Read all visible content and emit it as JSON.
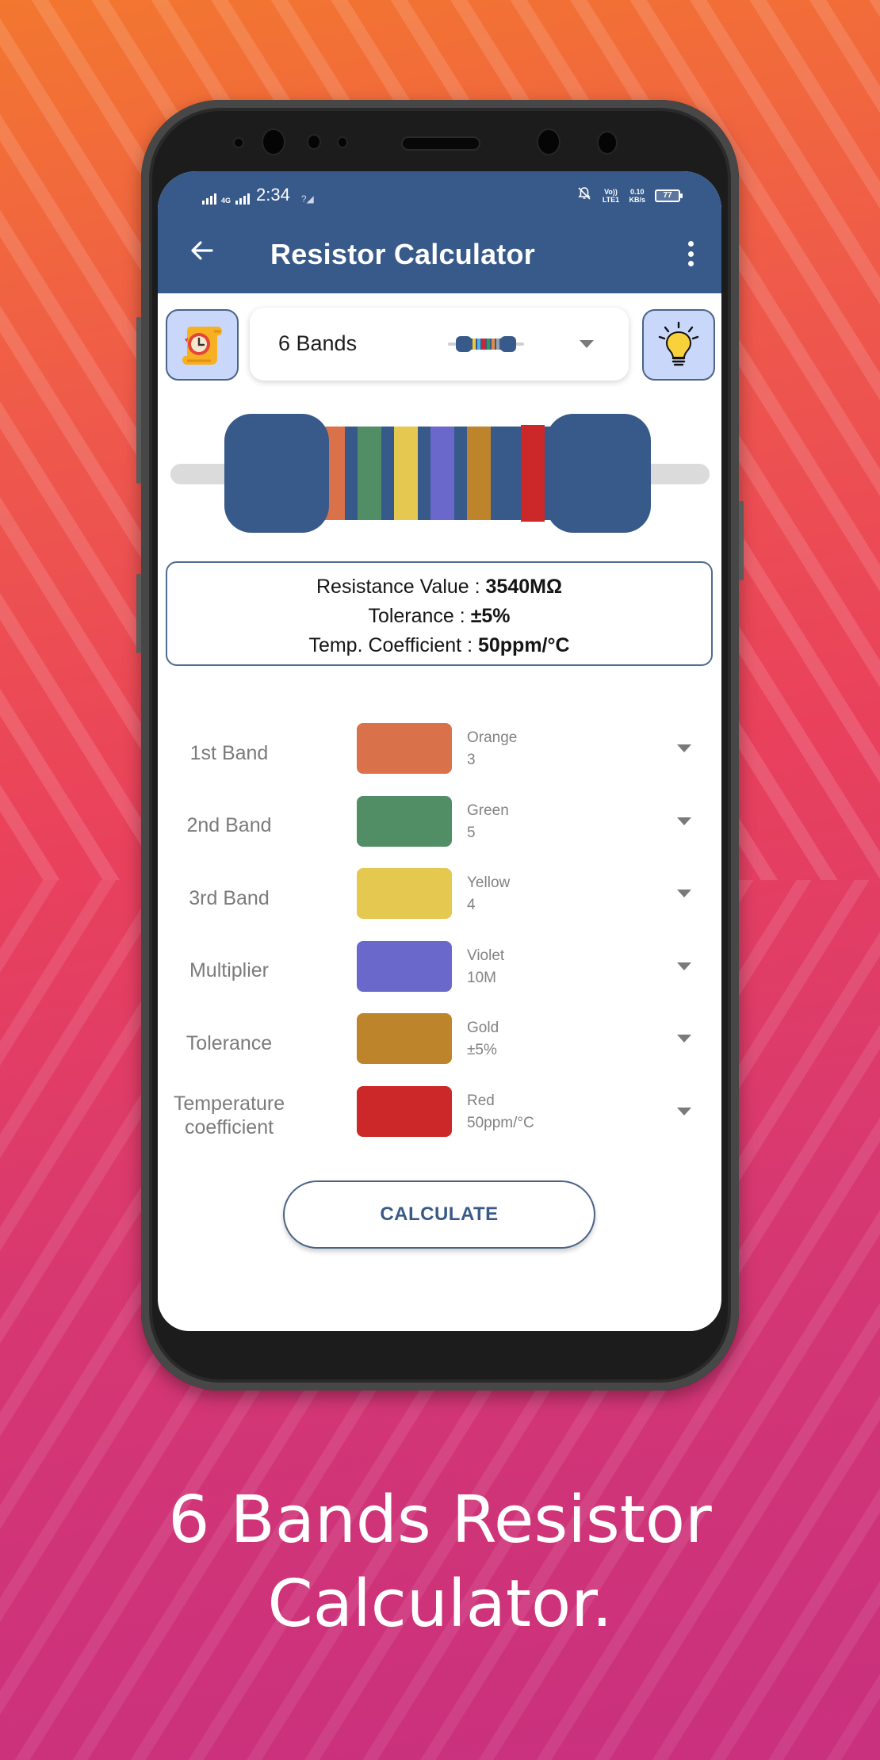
{
  "status_bar": {
    "network_label": "4G",
    "time": "2:34",
    "volte_label": "Vo)) LTE1",
    "speed_value": "0.10",
    "speed_unit": "KB/s",
    "battery": "77"
  },
  "app_bar": {
    "title": "Resistor Calculator",
    "back_icon": "arrow-left-icon",
    "menu_icon": "more-vert-icon"
  },
  "selector": {
    "history_icon": "history-scroll-icon",
    "band_option": "6 Bands",
    "tips_icon": "lightbulb-icon",
    "mini_resistor_bands": [
      "#f0c93a",
      "#4fb3e8",
      "#c8283a",
      "#2e9a52",
      "#e08a4a",
      "#9aa3ad"
    ]
  },
  "resistor": {
    "body_color": "#385a8a",
    "lead_color": "#dbdbdb",
    "bands": [
      "#d9724a",
      "#518e66",
      "#e5c84f",
      "#6a68cb",
      "#be842b",
      "#cc2729"
    ]
  },
  "result": {
    "resistance_label": "Resistance Value : ",
    "resistance_value": "3540MΩ",
    "tolerance_label": "Tolerance : ",
    "tolerance_value": "±5%",
    "tempco_label": "Temp. Coefficient : ",
    "tempco_value": "50ppm/°C"
  },
  "bands": [
    {
      "label": "1st Band",
      "color_name": "Orange",
      "value": "3",
      "hex": "#d9724a"
    },
    {
      "label": "2nd Band",
      "color_name": "Green",
      "value": "5",
      "hex": "#518e66"
    },
    {
      "label": "3rd Band",
      "color_name": "Yellow",
      "value": "4",
      "hex": "#e5c84f"
    },
    {
      "label": "Multiplier",
      "color_name": "Violet",
      "value": "10M",
      "hex": "#6a68cb"
    },
    {
      "label": "Tolerance",
      "color_name": "Gold",
      "value": "±5%",
      "hex": "#be842b"
    },
    {
      "label": "Temperature coefficient",
      "color_name": "Red",
      "value": "50ppm/°C",
      "hex": "#cc2729"
    }
  ],
  "calculate_label": "CALCULATE",
  "caption": {
    "line1": "6 Bands Resistor",
    "line2": "Calculator."
  },
  "theme": {
    "primary": "#385a8a",
    "icon_button_bg": "#c9d7fb"
  }
}
